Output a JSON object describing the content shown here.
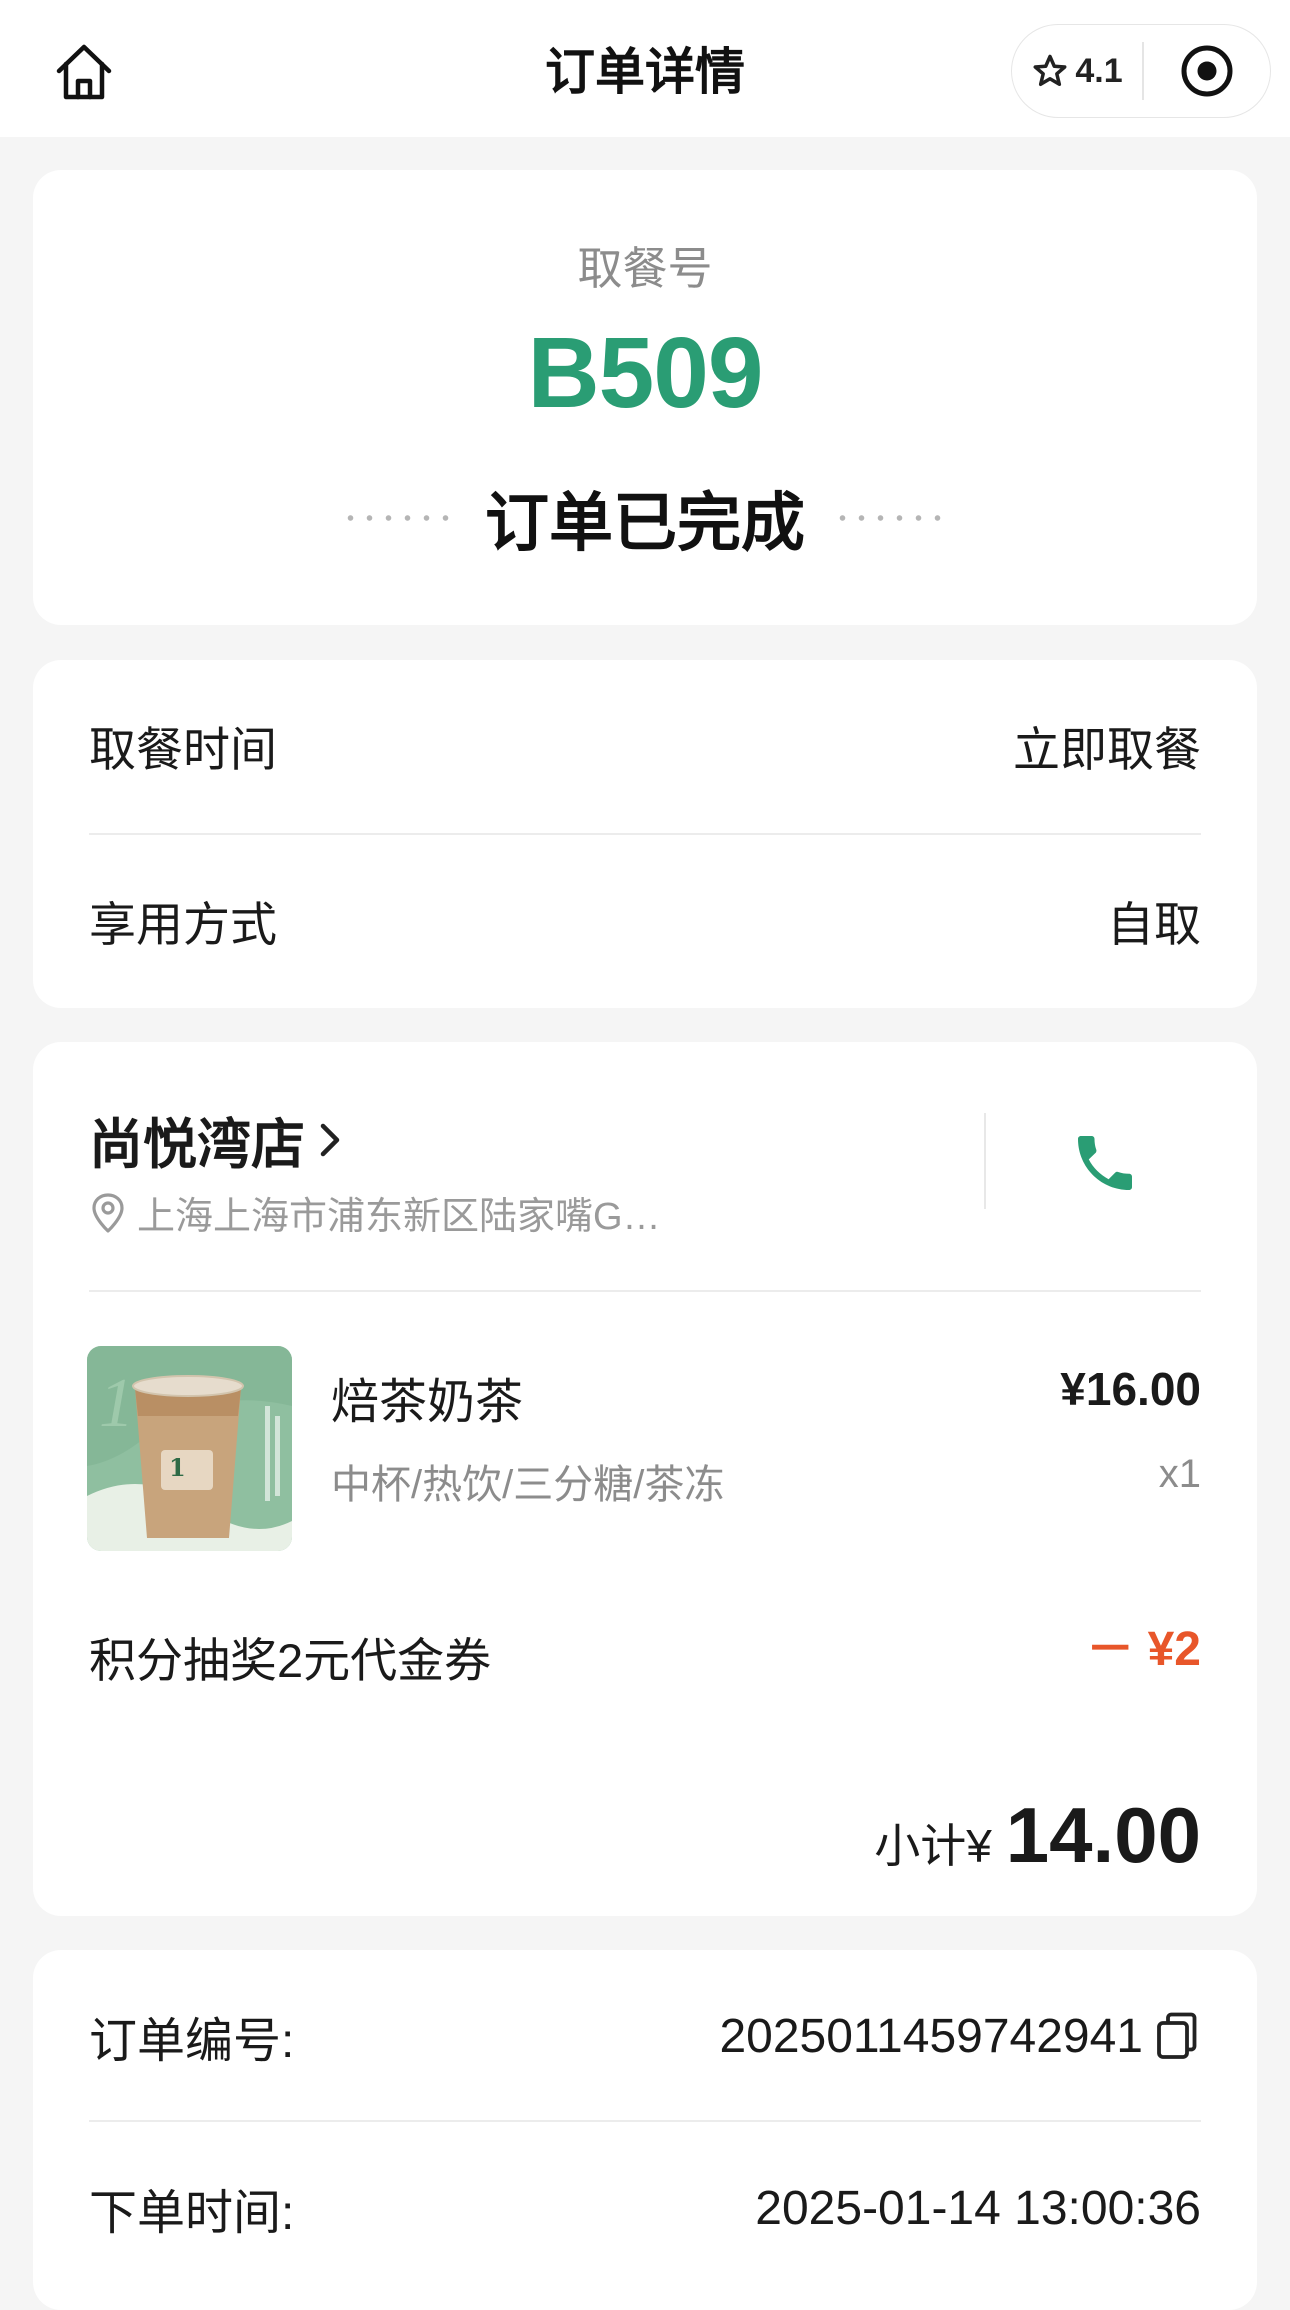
{
  "header": {
    "title": "订单详情",
    "rating": "4.1"
  },
  "pickup": {
    "label": "取餐号",
    "code": "B509",
    "status": "订单已完成"
  },
  "info": {
    "pickup_time_label": "取餐时间",
    "pickup_time_value": "立即取餐",
    "mode_label": "享用方式",
    "mode_value": "自取"
  },
  "store": {
    "name": "尚悦湾店",
    "address": "上海上海市浦东新区陆家嘴G…"
  },
  "items": [
    {
      "name": "焙茶奶茶",
      "spec": "中杯/热饮/三分糖/茶冻",
      "price": "¥16.00",
      "qty": "x1"
    }
  ],
  "discount": {
    "label": "积分抽奖2元代金券",
    "amount": "－ ¥2"
  },
  "subtotal": {
    "label": "小计¥",
    "value": "14.00"
  },
  "meta": {
    "order_no_label": "订单编号:",
    "order_no": "2025011459742941",
    "order_time_label": "下单时间:",
    "order_time": "2025-01-14 13:00:36"
  },
  "colors": {
    "accent_green": "#2a9d74",
    "discount_red": "#e8562a",
    "muted": "#8c8c8c"
  },
  "icons": {
    "home": "home-icon",
    "star": "star-icon",
    "record": "record-icon",
    "chevron": "chevron-right-icon",
    "location": "location-pin-icon",
    "phone": "phone-icon",
    "copy": "copy-icon"
  }
}
